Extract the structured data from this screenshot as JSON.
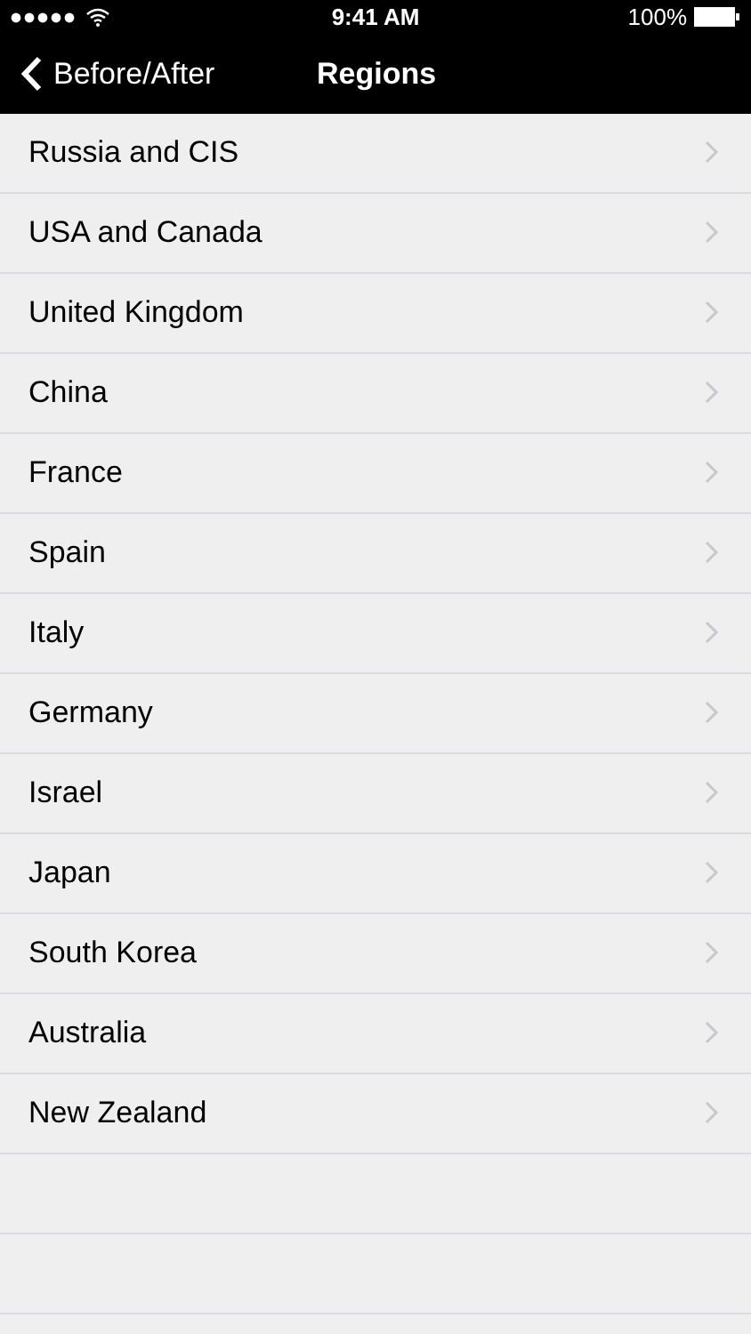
{
  "status_bar": {
    "time": "9:41 AM",
    "battery": "100%"
  },
  "nav_bar": {
    "back": "Before/After",
    "title": "Regions"
  },
  "regions": [
    {
      "label": "Russia and CIS"
    },
    {
      "label": "USA and Canada"
    },
    {
      "label": "United Kingdom"
    },
    {
      "label": "China"
    },
    {
      "label": "France"
    },
    {
      "label": "Spain"
    },
    {
      "label": "Italy"
    },
    {
      "label": "Germany"
    },
    {
      "label": "Israel"
    },
    {
      "label": "Japan"
    },
    {
      "label": "South Korea"
    },
    {
      "label": "Australia"
    },
    {
      "label": "New Zealand"
    }
  ]
}
